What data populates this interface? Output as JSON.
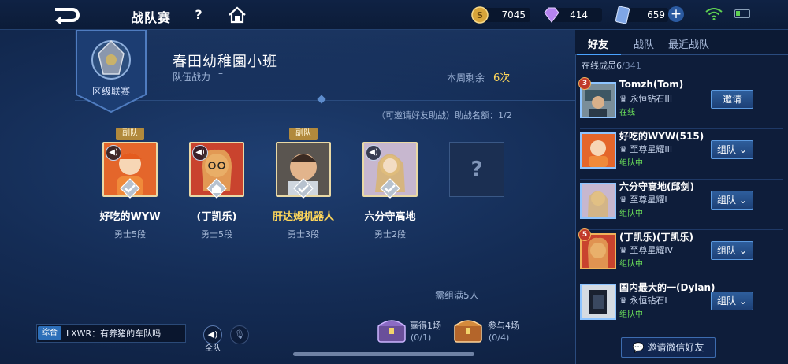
{
  "topbar": {
    "title": "战队赛",
    "help_icon": "?",
    "coins": "7045",
    "diamonds": "414",
    "vouchers": "659",
    "plus_icon": "+",
    "icons": [
      "back-arrow-icon",
      "help-icon",
      "home-icon",
      "gold-coin-icon",
      "diamond-icon",
      "voucher-icon",
      "plus-icon",
      "wifi-icon",
      "battery-icon"
    ]
  },
  "team": {
    "emblem_label": "区级联赛",
    "name": "春田幼稚園小班",
    "power_label": "队伍战力",
    "power_value": "–",
    "remain_label": "本周剩余",
    "remain_value": "6次",
    "invite_hint": "（可邀请好友助战）助战名额：1/2"
  },
  "members": [
    {
      "name": "好吃的WYW",
      "rank": "勇士5段",
      "tag": "副队",
      "name_color": "#ffffff",
      "avatar_bg": "#e4662b"
    },
    {
      "name": "(丁凯乐)",
      "rank": "勇士5段",
      "tag": "",
      "name_color": "#ffffff",
      "avatar_bg": "#c9432e"
    },
    {
      "name": "肝达姆机器人",
      "rank": "勇士3段",
      "tag": "副队",
      "name_color": "#ffd75a",
      "avatar_bg": "#8a7f78"
    },
    {
      "name": "六分守高地",
      "rank": "勇士2段",
      "tag": "",
      "name_color": "#ffffff",
      "avatar_bg": "#d9c39a"
    }
  ],
  "empty_slot": "?",
  "need_five": "需组满5人",
  "chests": [
    {
      "title": "赢得1场",
      "progress": "(0/1)",
      "color": "#7d5bb0"
    },
    {
      "title": "参与4场",
      "progress": "(0/4)",
      "color": "#c6772f"
    }
  ],
  "chat": {
    "tag": "综合",
    "message": "LXWR：有养猪的车队吗",
    "voice_label": "全队"
  },
  "friends_panel": {
    "tabs": [
      "好友",
      "战队",
      "最近战队"
    ],
    "online_label": "在线成员6",
    "online_total": "/341",
    "friends": [
      {
        "name": "Tomzh(Tom)",
        "rank": "永恒钻石III",
        "status": "在线",
        "button": "邀请",
        "level": "3"
      },
      {
        "name": "好吃的WYW(515)",
        "rank": "至尊星耀III",
        "status": "组队中",
        "button": "组队",
        "level": ""
      },
      {
        "name": "六分守高地(邱剑)",
        "rank": "至尊星耀I",
        "status": "组队中",
        "button": "组队",
        "level": ""
      },
      {
        "name": "(丁凯乐)(丁凯乐)",
        "rank": "至尊星耀IV",
        "status": "组队中",
        "button": "组队",
        "level": "5"
      },
      {
        "name": "国内最大的一(Dylan)",
        "rank": "永恒钻石I",
        "status": "组队中",
        "button": "组队",
        "level": ""
      }
    ],
    "wechat_button": "邀请微信好友"
  }
}
